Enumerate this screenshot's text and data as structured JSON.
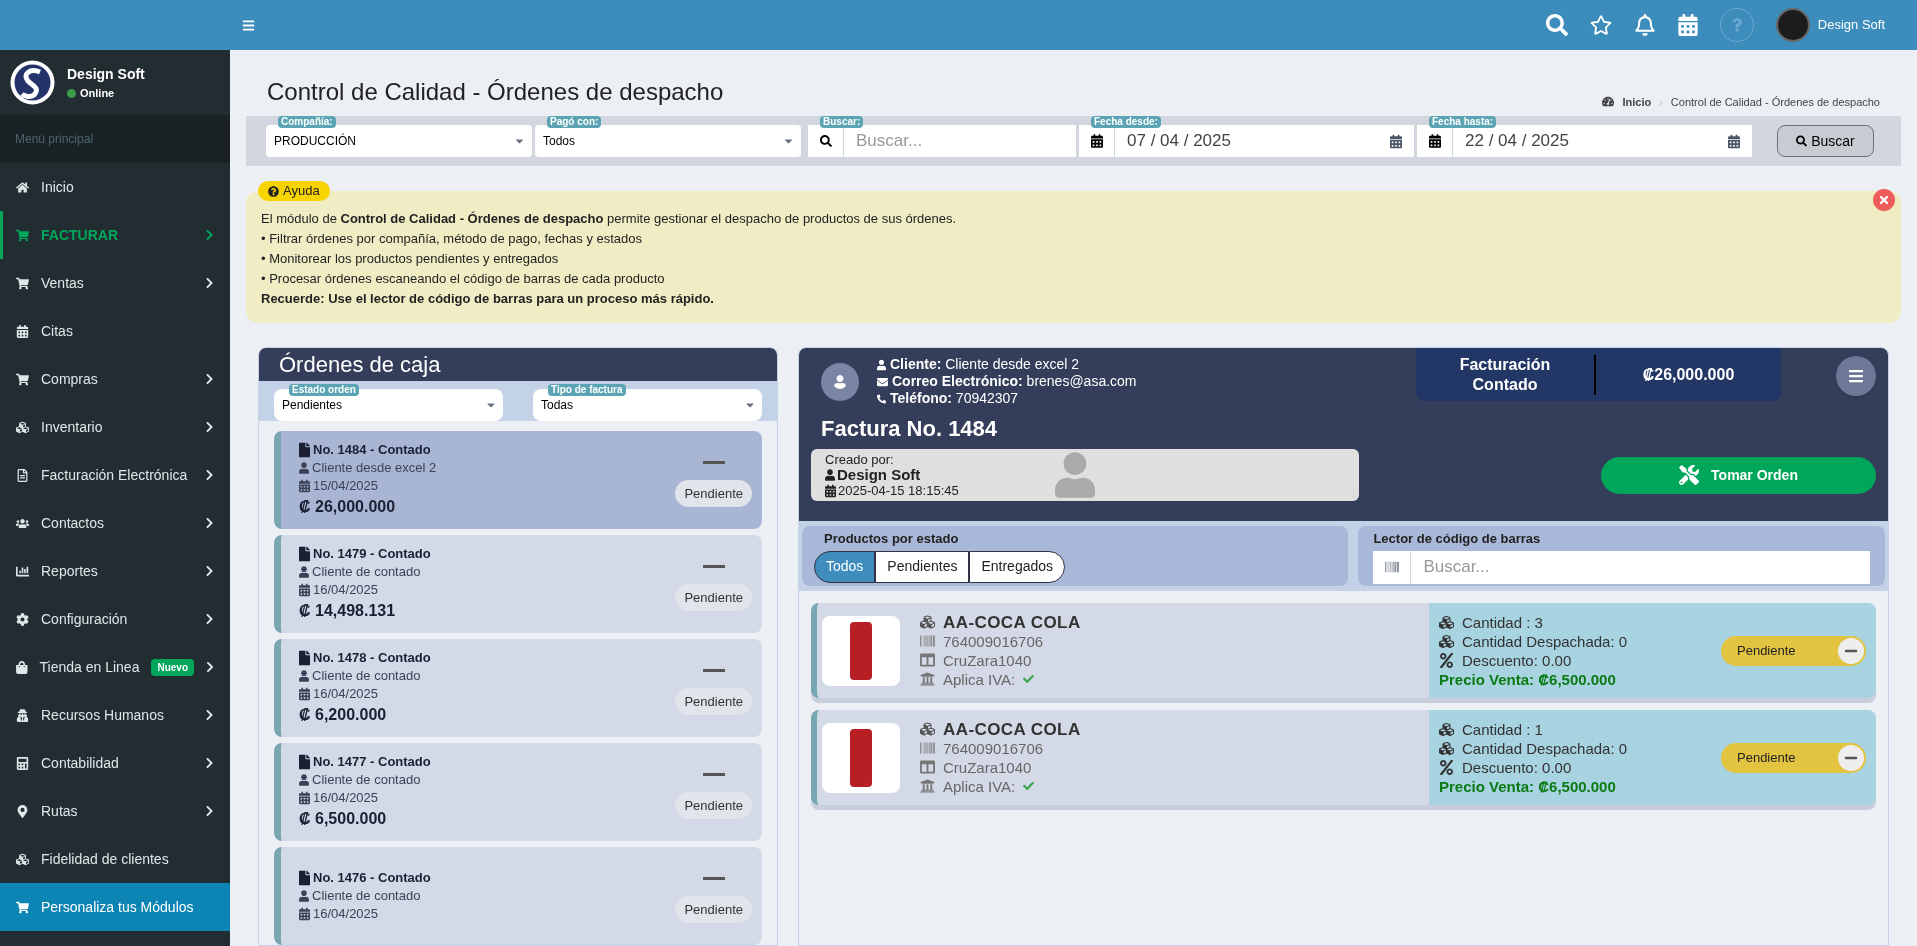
{
  "topbar": {
    "user_name": "Design Soft"
  },
  "sidebar": {
    "user": {
      "name": "Design Soft",
      "status": "Online"
    },
    "section": "Menú principal",
    "items": [
      {
        "label": "Inicio",
        "expandable": false,
        "active": false,
        "highlighted": false
      },
      {
        "label": "FACTURAR",
        "expandable": true,
        "active": true,
        "highlighted": false
      },
      {
        "label": "Ventas",
        "expandable": true,
        "active": false,
        "highlighted": false
      },
      {
        "label": "Citas",
        "expandable": false,
        "active": false,
        "highlighted": false
      },
      {
        "label": "Compras",
        "expandable": true,
        "active": false,
        "highlighted": false
      },
      {
        "label": "Inventario",
        "expandable": true,
        "active": false,
        "highlighted": false
      },
      {
        "label": "Facturación Electrónica",
        "expandable": true,
        "active": false,
        "highlighted": false
      },
      {
        "label": "Contactos",
        "expandable": true,
        "active": false,
        "highlighted": false
      },
      {
        "label": "Reportes",
        "expandable": true,
        "active": false,
        "highlighted": false
      },
      {
        "label": "Configuración",
        "expandable": true,
        "active": false,
        "highlighted": false
      },
      {
        "label": "Tienda en Linea",
        "expandable": true,
        "active": false,
        "highlighted": false,
        "badge": "Nuevo"
      },
      {
        "label": "Recursos Humanos",
        "expandable": true,
        "active": false,
        "highlighted": false
      },
      {
        "label": "Contabilidad",
        "expandable": true,
        "active": false,
        "highlighted": false
      },
      {
        "label": "Rutas",
        "expandable": true,
        "active": false,
        "highlighted": false
      },
      {
        "label": "Fidelidad de clientes",
        "expandable": false,
        "active": false,
        "highlighted": false
      },
      {
        "label": "Personaliza tus Módulos",
        "expandable": false,
        "active": false,
        "highlighted": true
      }
    ]
  },
  "page": {
    "title": "Control de Calidad - Órdenes de despacho",
    "breadcrumb": [
      "Inicio",
      "Control de Calidad - Órdenes de despacho"
    ],
    "breadcrumb_separator": "›"
  },
  "filters": {
    "company": {
      "label": "Compañía:",
      "value": "PRODUCCIÓN"
    },
    "payment": {
      "label": "Pagó con:",
      "value": "Todos"
    },
    "search": {
      "label": "Buscar:",
      "placeholder": "Buscar..."
    },
    "date_from": {
      "label": "Fecha desde:",
      "value": "07 / 04 / 2025"
    },
    "date_to": {
      "label": "Fecha hasta:",
      "value": "22 / 04 / 2025"
    },
    "button": "Buscar"
  },
  "help": {
    "badge": "Ayuda",
    "lines": [
      "El módulo de **Control de Calidad - Órdenes de despacho** permite gestionar el despacho de productos de sus órdenes.",
      "• Filtrar órdenes por compañía, método de pago, fechas y estados",
      "• Monitorear los productos pendientes y entregados",
      "• Procesar órdenes escaneando el código de barras de cada producto"
    ],
    "note": "Recuerde: Use el lector de código de barras para un proceso más rápido."
  },
  "orders_panel": {
    "title": "Órdenes de caja",
    "status_filter": {
      "label": "Estado orden",
      "value": "Pendientes"
    },
    "type_filter": {
      "label": "Tipo de factura",
      "value": "Todas"
    },
    "orders": [
      {
        "title": "No. 1484 - Contado",
        "client": "Cliente desde excel 2",
        "date": "15/04/2025",
        "amount": "₡ 26,000.000",
        "status": "Pendiente",
        "selected": true
      },
      {
        "title": "No. 1479 - Contado",
        "client": "Cliente de contado",
        "date": "16/04/2025",
        "amount": "₡ 14,498.131",
        "status": "Pendiente",
        "selected": false
      },
      {
        "title": "No. 1478 - Contado",
        "client": "Cliente de contado",
        "date": "16/04/2025",
        "amount": "₡ 6,200.000",
        "status": "Pendiente",
        "selected": false
      },
      {
        "title": "No. 1477 - Contado",
        "client": "Cliente de contado",
        "date": "16/04/2025",
        "amount": "₡ 6,500.000",
        "status": "Pendiente",
        "selected": false
      },
      {
        "title": "No. 1476 - Contado",
        "client": "Cliente de contado",
        "date": "16/04/2025",
        "status": "Pendiente",
        "selected": false
      }
    ]
  },
  "invoice": {
    "client_label": "Cliente:",
    "client": "Cliente desde excel 2",
    "email_label": "Correo Electrónico:",
    "email": "brenes@asa.com",
    "phone_label": "Teléfono:",
    "phone": "70942307",
    "billing_type": "Facturación Contado",
    "total": "₡26,000.000",
    "title": "Factura No. 1484",
    "created_label": "Creado por:",
    "created_by": "Design Soft",
    "created_at": "2025-04-15 18:15:45",
    "take_button": "Tomar Orden",
    "status_label": "Productos por estado",
    "tabs": [
      {
        "label": "Todos",
        "selected": true
      },
      {
        "label": "Pendientes",
        "selected": false
      },
      {
        "label": "Entregados",
        "selected": false
      }
    ],
    "scanner_label": "Lector de código de barras",
    "scanner_placeholder": "Buscar...",
    "products": [
      {
        "name": "AA-COCA COLA",
        "barcode": "764009016706",
        "code": "CruZara1040",
        "iva_label": "Aplica IVA:",
        "iva": true,
        "quantity": "Cantidad : 3",
        "dispatched": "Cantidad Despachada: 0",
        "discount": "Descuento: 0.00",
        "price": "Precio Venta: ₡6,500.000",
        "status": "Pendiente"
      },
      {
        "name": "AA-COCA COLA",
        "barcode": "764009016706",
        "code": "CruZara1040",
        "iva_label": "Aplica IVA:",
        "iva": true,
        "quantity": "Cantidad : 1",
        "dispatched": "Cantidad Despachada: 0",
        "discount": "Descuento: 0.00",
        "price": "Precio Venta: ₡6,500.000",
        "status": "Pendiente"
      }
    ]
  }
}
